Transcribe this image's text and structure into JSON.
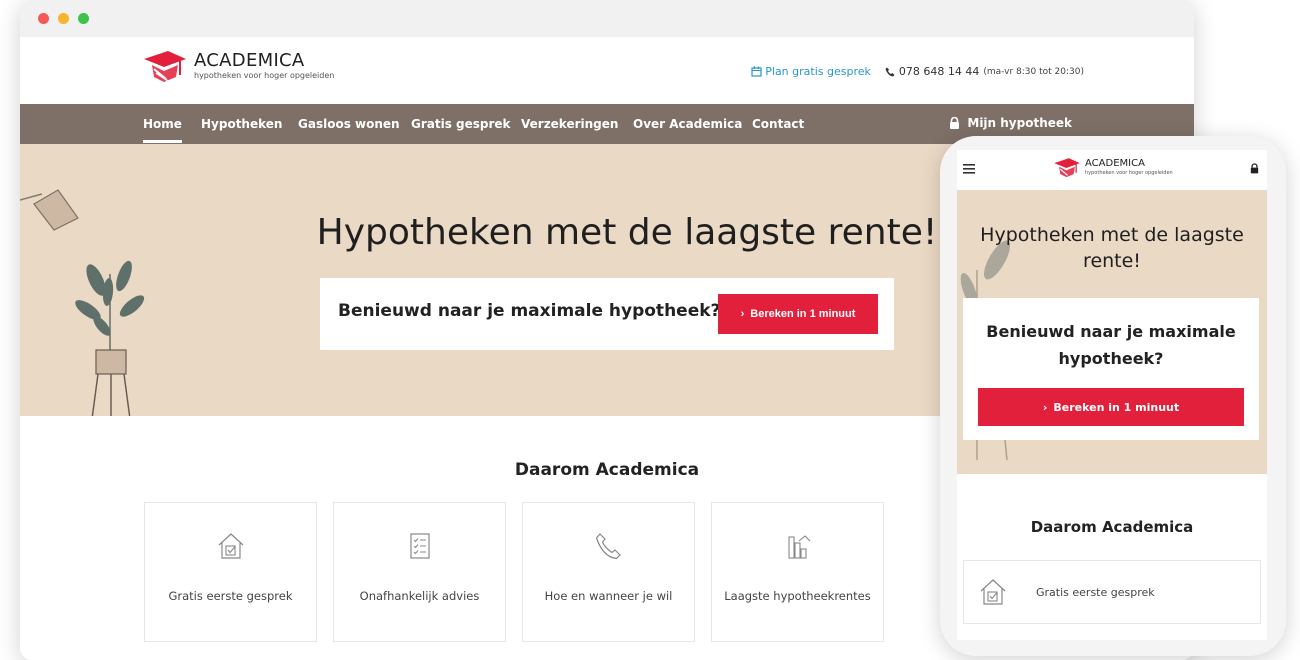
{
  "brand": {
    "name": "ACADEMICA",
    "tagline": "hypotheken voor hoger opgeleiden",
    "primary_color": "#e3203b",
    "nav_color": "#7e7067",
    "hero_color": "#ead9c5"
  },
  "header": {
    "plan_link": "Plan gratis gesprek",
    "phone": "078 648 14 44",
    "hours": "(ma-vr 8:30 tot 20:30)"
  },
  "nav": {
    "items": [
      "Home",
      "Hypotheken",
      "Gasloos wonen",
      "Gratis gesprek",
      "Verzekeringen",
      "Over Academica",
      "Contact"
    ],
    "active": "Home",
    "account_label": "Mijn hypotheek"
  },
  "hero": {
    "title": "Hypotheken met de laagste rente!",
    "question": "Benieuwd naar je maximale hypotheek?",
    "cta_label": "Bereken in 1 minuut"
  },
  "why": {
    "title": "Daarom Academica",
    "cards": [
      {
        "label": "Gratis eerste gesprek",
        "icon": "house-check-icon"
      },
      {
        "label": "Onafhankelijk advies",
        "icon": "checklist-icon"
      },
      {
        "label": "Hoe en wanneer je wil",
        "icon": "phone-icon"
      },
      {
        "label": "Laagste hypotheekrentes",
        "icon": "chart-house-icon"
      }
    ]
  },
  "mobile": {
    "title": "Hypotheken met de laagste rente!",
    "question": "Benieuwd naar je maximale hypotheek?",
    "cta_label": "Bereken in 1 minuut",
    "section_title": "Daarom Academica",
    "first_card": "Gratis eerste gesprek"
  }
}
